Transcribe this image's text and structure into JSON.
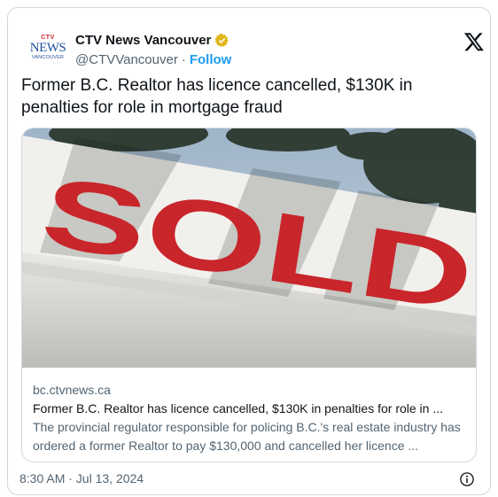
{
  "account": {
    "display_name": "CTV News Vancouver",
    "handle": "@CTVVancouver",
    "separator": "·",
    "follow_label": "Follow",
    "avatar": {
      "logo_top": "CTV",
      "logo_main": "NEWS",
      "logo_bottom": "VANCOUVER"
    }
  },
  "tweet": {
    "text": "Former B.C. Realtor has licence cancelled, $130K in penalties for role in mortgage fraud"
  },
  "link_card": {
    "image_text": "SOLD",
    "domain": "bc.ctvnews.ca",
    "title": "Former B.C. Realtor has licence cancelled, $130K in penalties for role in ...",
    "description": "The provincial regulator responsible for policing B.C.'s real estate industry has ordered a former Realtor to pay $130,000 and cancelled her licence ..."
  },
  "footer": {
    "timestamp": "8:30 AM · Jul 13, 2024"
  },
  "icons": {
    "verified": "verified-badge-icon",
    "x_logo": "x-logo-icon",
    "info": "info-icon"
  },
  "colors": {
    "link_blue": "#1d9bf0",
    "muted": "#536471",
    "verified_gold": "#e2b719",
    "sold_red": "#c8262b"
  }
}
